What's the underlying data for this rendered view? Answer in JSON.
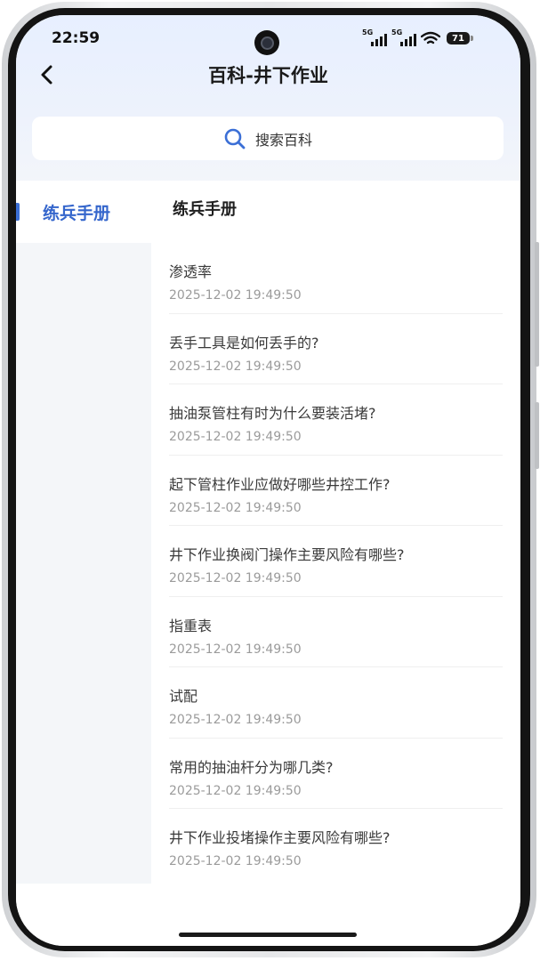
{
  "status_bar": {
    "time": "22:59",
    "network_1": "5G",
    "network_2": "5G",
    "battery": "71"
  },
  "header": {
    "title": "百科-井下作业",
    "back_icon": "chevron-left-icon"
  },
  "search": {
    "placeholder": "搜索百科",
    "icon": "search-icon",
    "icon_color": "#3b6fd6"
  },
  "sidebar": {
    "items": [
      {
        "label": "练兵手册",
        "active": true
      }
    ],
    "accent_color": "#3566cc"
  },
  "section": {
    "title": "练兵手册"
  },
  "articles": [
    {
      "title": "渗透率",
      "date": "2025-12-02 19:49:50"
    },
    {
      "title": "丢手工具是如何丢手的?",
      "date": "2025-12-02 19:49:50"
    },
    {
      "title": "抽油泵管柱有时为什么要装活堵?",
      "date": "2025-12-02 19:49:50"
    },
    {
      "title": "起下管柱作业应做好哪些井控工作?",
      "date": "2025-12-02 19:49:50"
    },
    {
      "title": "井下作业换阀门操作主要风险有哪些?",
      "date": "2025-12-02 19:49:50"
    },
    {
      "title": "指重表",
      "date": "2025-12-02 19:49:50"
    },
    {
      "title": "试配",
      "date": "2025-12-02 19:49:50"
    },
    {
      "title": "常用的抽油杆分为哪几类?",
      "date": "2025-12-02 19:49:50"
    },
    {
      "title": "井下作业投堵操作主要风险有哪些?",
      "date": "2025-12-02 19:49:50"
    }
  ]
}
